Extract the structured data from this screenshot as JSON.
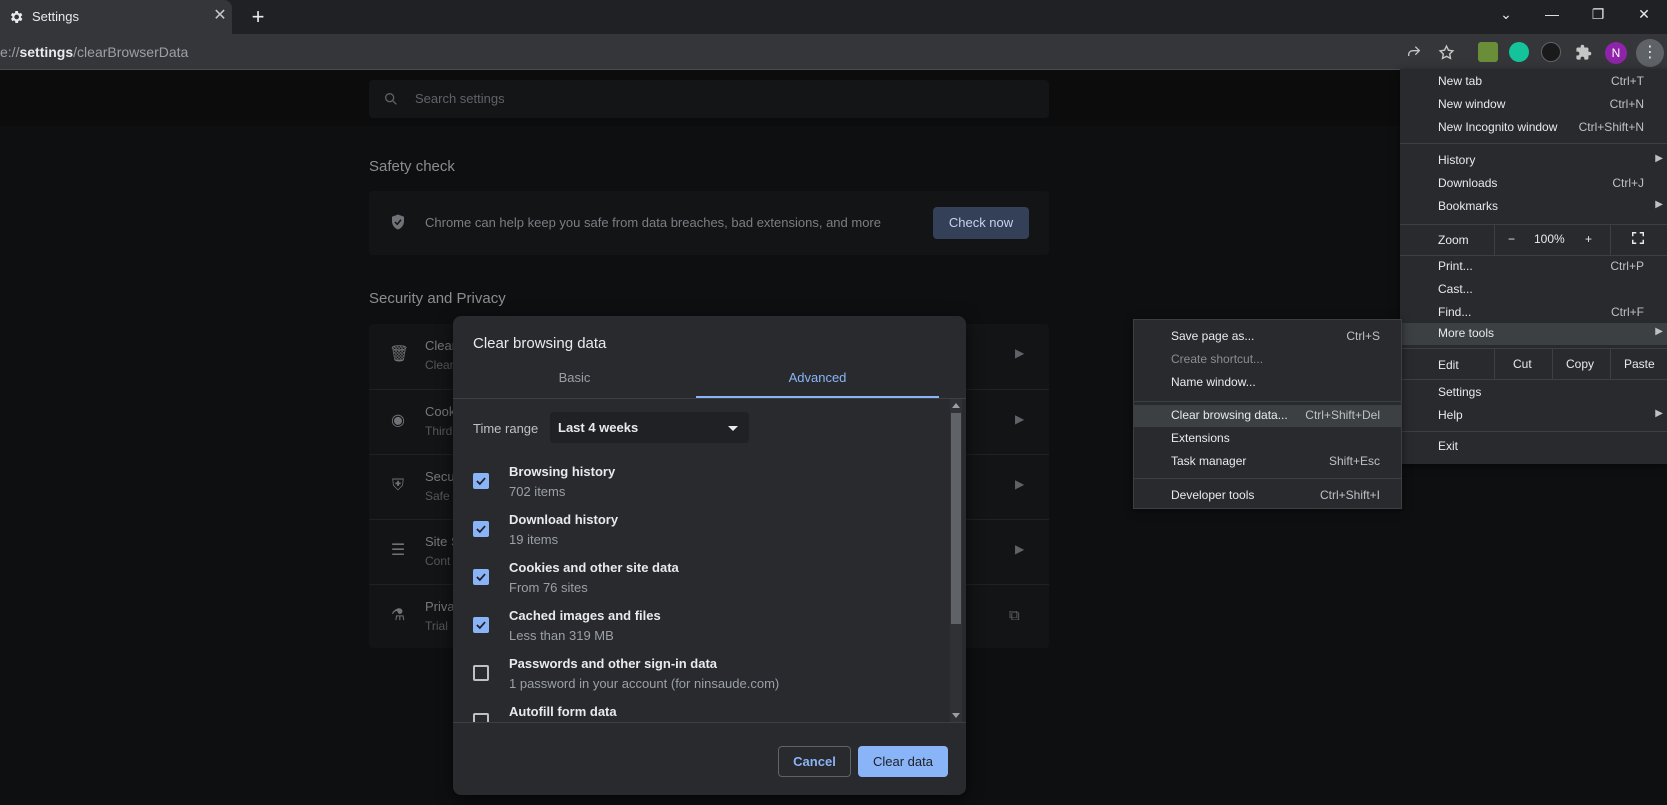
{
  "tab": {
    "title": "Settings",
    "close_glyph": "✕"
  },
  "newtab_glyph": "+",
  "window": {
    "minimize": "—",
    "maximize": "❐",
    "close": "✕",
    "dropdown": "⌄"
  },
  "url": {
    "prefix": "e://",
    "host": "settings",
    "path": "/clearBrowserData"
  },
  "toolbar": {
    "avatar_letter": "N",
    "kebab_glyph": "⋮"
  },
  "search": {
    "placeholder": "Search settings"
  },
  "safety": {
    "title": "Safety check",
    "text": "Chrome can help keep you safe from data breaches, bad extensions, and more",
    "button": "Check now"
  },
  "privacy": {
    "title": "Security and Privacy",
    "rows": [
      {
        "t1": "Clear",
        "t2": "Clear"
      },
      {
        "t1": "Cook",
        "t2": "Third"
      },
      {
        "t1": "Secu",
        "t2": "Safe"
      },
      {
        "t1": "Site S",
        "t2": "Cont"
      },
      {
        "t1": "Priva",
        "t2": "Trial"
      }
    ]
  },
  "dialog": {
    "title": "Clear browsing data",
    "tabs": {
      "basic": "Basic",
      "advanced": "Advanced"
    },
    "time_range_label": "Time range",
    "time_range_value": "Last 4 weeks",
    "options": [
      {
        "label": "Browsing history",
        "detail": "702 items",
        "checked": true
      },
      {
        "label": "Download history",
        "detail": "19 items",
        "checked": true
      },
      {
        "label": "Cookies and other site data",
        "detail": "From 76 sites",
        "checked": true
      },
      {
        "label": "Cached images and files",
        "detail": "Less than 319 MB",
        "checked": true
      },
      {
        "label": "Passwords and other sign-in data",
        "detail": "1 password in your account (for ninsaude.com)",
        "checked": false
      },
      {
        "label": "Autofill form data",
        "detail": "",
        "checked": false
      }
    ],
    "cancel": "Cancel",
    "clear": "Clear data"
  },
  "menu": {
    "new_tab": "New tab",
    "new_tab_sc": "Ctrl+T",
    "new_window": "New window",
    "new_window_sc": "Ctrl+N",
    "incognito": "New Incognito window",
    "incognito_sc": "Ctrl+Shift+N",
    "history": "History",
    "downloads": "Downloads",
    "downloads_sc": "Ctrl+J",
    "bookmarks": "Bookmarks",
    "zoom": "Zoom",
    "zoom_minus": "−",
    "zoom_value": "100%",
    "zoom_plus": "+",
    "print": "Print...",
    "print_sc": "Ctrl+P",
    "cast": "Cast...",
    "find": "Find...",
    "find_sc": "Ctrl+F",
    "more_tools": "More tools",
    "edit": "Edit",
    "cut": "Cut",
    "copy": "Copy",
    "paste": "Paste",
    "settings": "Settings",
    "help": "Help",
    "exit": "Exit",
    "submenu_arrow": "▶"
  },
  "submenu": {
    "save_page": "Save page as...",
    "save_page_sc": "Ctrl+S",
    "create_shortcut": "Create shortcut...",
    "name_window": "Name window...",
    "clear_data": "Clear browsing data...",
    "clear_data_sc": "Ctrl+Shift+Del",
    "extensions": "Extensions",
    "task_manager": "Task manager",
    "task_manager_sc": "Shift+Esc",
    "dev_tools": "Developer tools",
    "dev_tools_sc": "Ctrl+Shift+I"
  }
}
